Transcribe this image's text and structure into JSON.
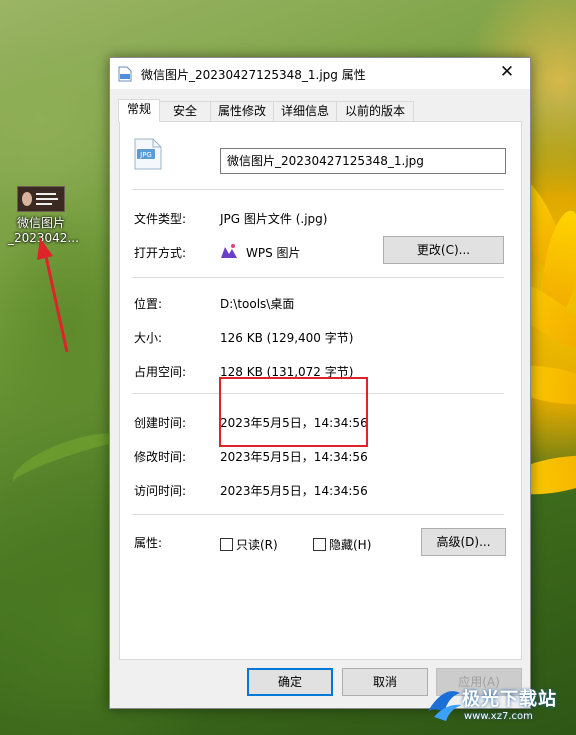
{
  "desktop": {
    "icon_label": "微信图片\n_2023042..."
  },
  "dialog": {
    "title": "微信图片_20230427125348_1.jpg 属性",
    "close_glyph": "✕",
    "tabs": [
      "常规",
      "安全",
      "属性修改",
      "详细信息",
      "以前的版本"
    ],
    "active_tab": "常规",
    "filename": "微信图片_20230427125348_1.jpg",
    "file_type_label": "文件类型:",
    "file_type_value": "JPG 图片文件 (.jpg)",
    "opens_with_label": "打开方式:",
    "opens_with_value": "WPS 图片",
    "change_button": "更改(C)...",
    "location_label": "位置:",
    "location_value": "D:\\tools\\桌面",
    "size_label": "大小:",
    "size_value": "126 KB (129,400 字节)",
    "disk_size_label": "占用空间:",
    "disk_size_value": "128 KB (131,072 字节)",
    "created_label": "创建时间:",
    "created_value": "2023年5月5日，14:34:56",
    "modified_label": "修改时间:",
    "modified_value": "2023年5月5日，14:34:56",
    "accessed_label": "访问时间:",
    "accessed_value": "2023年5月5日，14:34:56",
    "attributes_label": "属性:",
    "readonly_label": "只读(R)",
    "hidden_label": "隐藏(H)",
    "advanced_button": "高级(D)...",
    "ok_button": "确定",
    "cancel_button": "取消",
    "apply_button": "应用(A)",
    "file_icon_text": "JPG"
  },
  "watermark": {
    "title": "极光下载站",
    "url": "www.xz7.com"
  },
  "colors": {
    "highlight_box": "#e0232a",
    "annotation_arrow": "#e0232a",
    "primary_border": "#0078d7"
  }
}
